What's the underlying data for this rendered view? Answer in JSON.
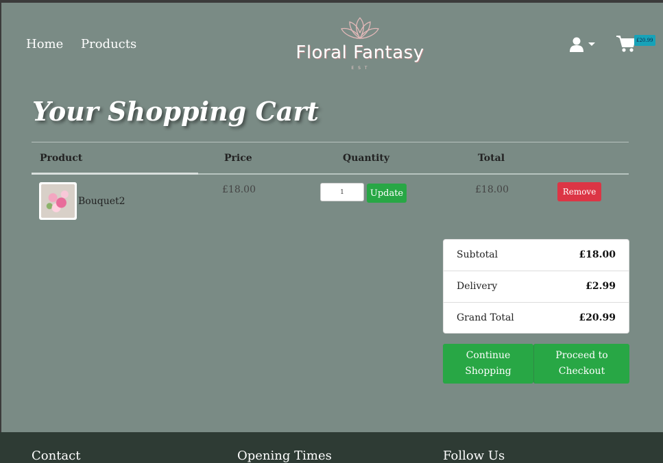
{
  "nav": {
    "home": "Home",
    "products": "Products"
  },
  "brand": {
    "name": "Floral Fantasy",
    "tagline": "E S T"
  },
  "header": {
    "user_icon": "user-icon",
    "cart_icon": "shopping-cart-icon",
    "cart_total": "£20.99"
  },
  "page": {
    "title": "Your Shopping Cart"
  },
  "table": {
    "headers": {
      "product": "Product",
      "price": "Price",
      "quantity": "Quantity",
      "total": "Total"
    },
    "rows": [
      {
        "name": "Bouquet2",
        "price": "£18.00",
        "quantity": "1",
        "total": "£18.00",
        "update_label": "Update",
        "remove_label": "Remove"
      }
    ]
  },
  "summary": {
    "subtotal_label": "Subtotal",
    "subtotal": "£18.00",
    "delivery_label": "Delivery",
    "delivery": "£2.99",
    "grand_total_label": "Grand Total",
    "grand_total": "£20.99"
  },
  "actions": {
    "continue": "Continue Shopping",
    "checkout": "Proceed to Checkout"
  },
  "footer": {
    "contact": "Contact",
    "opening_times": "Opening Times",
    "follow_us": "Follow Us"
  },
  "colors": {
    "background": "#7a8b85",
    "success": "#28a745",
    "danger": "#dc3545",
    "badge": "#17a2b8",
    "footer": "#2e3b34"
  }
}
